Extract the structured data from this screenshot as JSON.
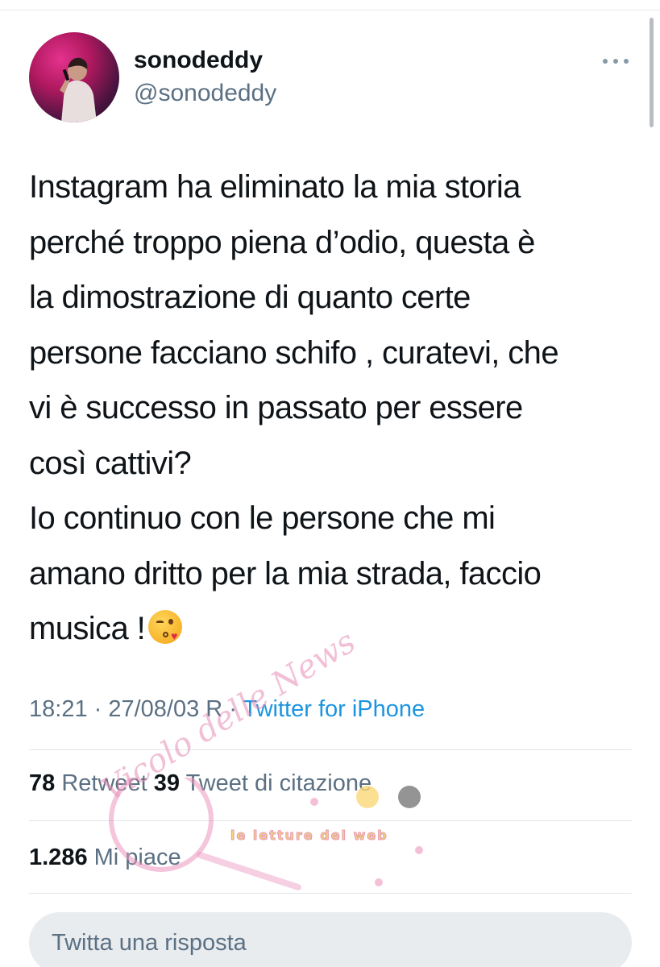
{
  "user": {
    "display_name": "sonodeddy",
    "handle": "@sonodeddy"
  },
  "tweet": {
    "lines": [
      "Instagram ha eliminato la mia storia",
      "perché troppo piena d’odio, questa è",
      "la dimostrazione di quanto certe",
      "persone facciano schifo , curatevi, che",
      "vi è successo in passato per essere",
      "così cattivi?",
      "Io continuo con le persone che mi",
      "amano dritto per la mia strada, faccio",
      "musica !"
    ],
    "emoji": "face-blowing-a-kiss-icon"
  },
  "meta": {
    "time_date": "18:21 · 27/08/03 R · ",
    "source": "Twitter for iPhone"
  },
  "stats": {
    "retweets_count": "78",
    "retweets_label": " Retweet  ",
    "quotes_count": "39",
    "quotes_label": " Tweet di citazione",
    "likes_count": "1.286",
    "likes_label": " Mi piace"
  },
  "reply": {
    "placeholder": "Twitta una risposta"
  },
  "watermark": {
    "text": "Vicolo delle News",
    "badge": "le letture del web"
  },
  "colors": {
    "text": "#0f1419",
    "secondary": "#5b7083",
    "link": "#1b95e0",
    "divider": "#e1e6ea",
    "reply_bg": "#e9ecef"
  }
}
